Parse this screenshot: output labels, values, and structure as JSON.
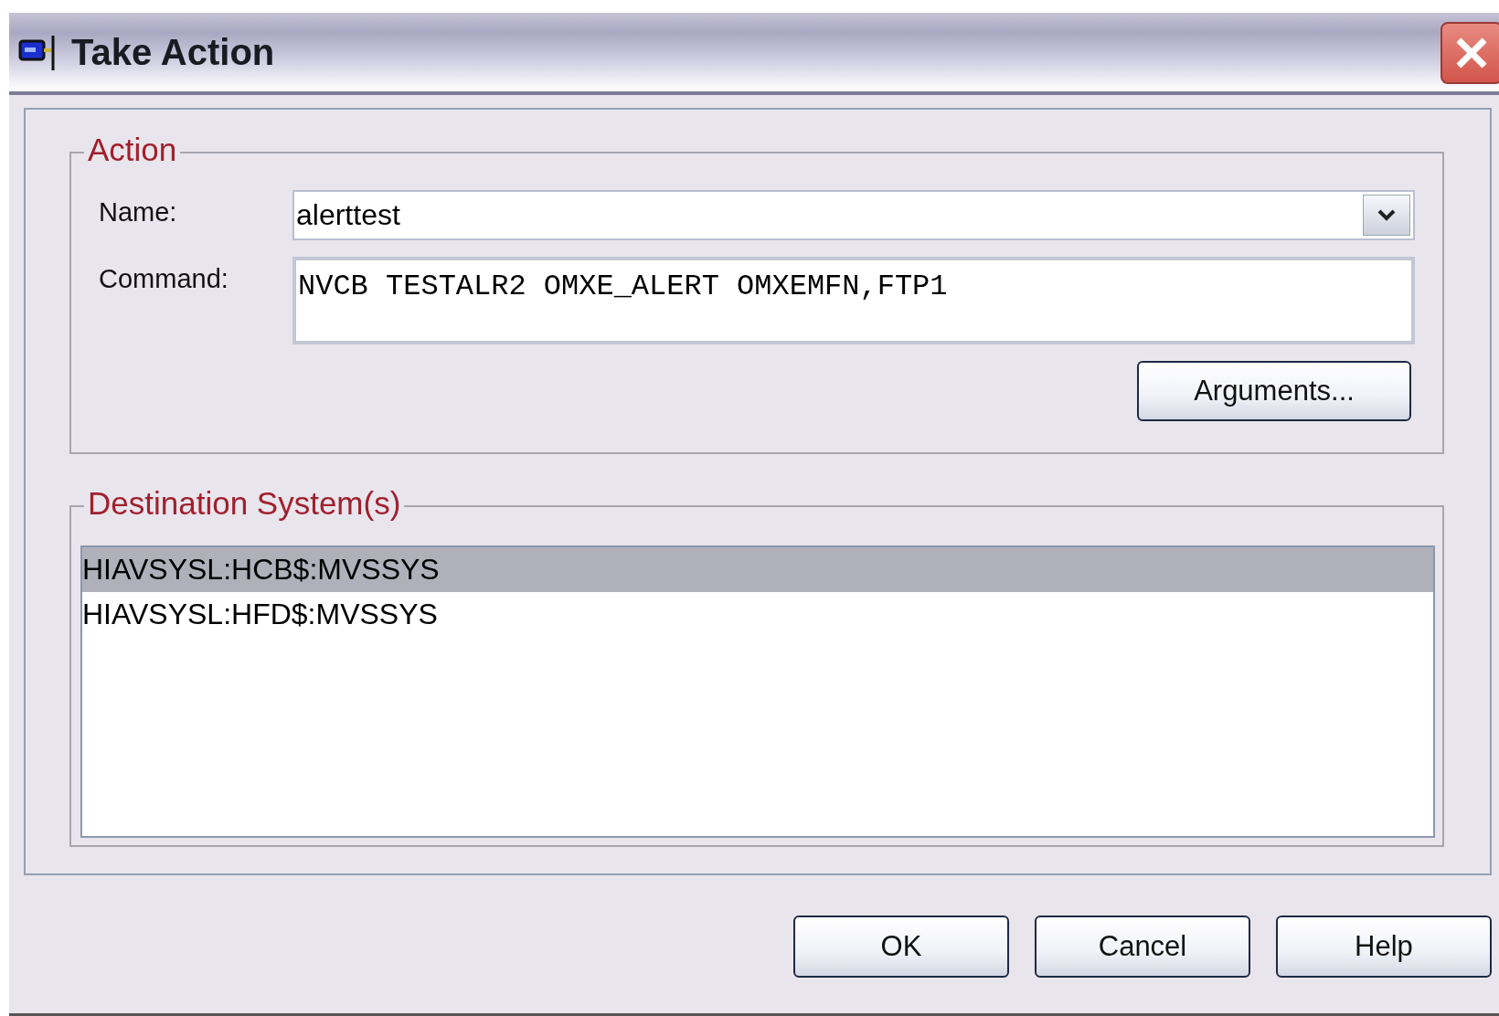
{
  "window": {
    "title": "Take Action"
  },
  "action": {
    "legend": "Action",
    "name_label": "Name:",
    "name_value": "alerttest",
    "command_label": "Command:",
    "command_value": "NVCB TESTALR2 OMXE_ALERT OMXEMFN,FTP1",
    "arguments_button": "Arguments..."
  },
  "destination": {
    "legend": "Destination System(s)",
    "items": [
      {
        "label": "HIAVSYSL:HCB$:MVSSYS",
        "selected": true
      },
      {
        "label": "HIAVSYSL:HFD$:MVSSYS",
        "selected": false
      }
    ]
  },
  "buttons": [
    "OK",
    "Cancel",
    "Help"
  ]
}
